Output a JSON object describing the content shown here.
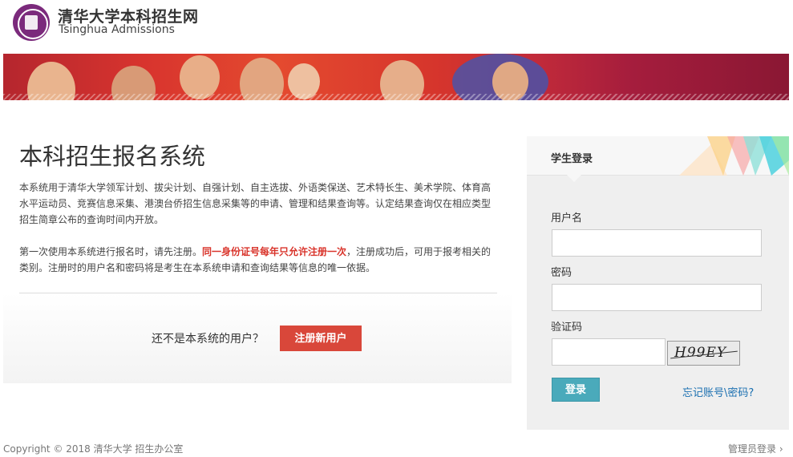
{
  "header": {
    "logo_cn": "清华大学本科招生网",
    "logo_en": "Tsinghua Admissions"
  },
  "intro": {
    "title": "本科招生报名系统",
    "para1": "本系统用于清华大学领军计划、拔尖计划、自强计划、自主选拔、外语类保送、艺术特长生、美术学院、体育高水平运动员、竞赛信息采集、港澳台侨招生信息采集等的申请、管理和结果查询等。认定结果查询仅在相应类型招生简章公布的查询时间内开放。",
    "para2_a": "第一次使用本系统进行报名时，请先注册。",
    "para2_red": "同一身份证号每年只允许注册一次",
    "para2_b": "，注册成功后，可用于报考相关的类别。注册时的用户名和密码将是考生在本系统申请和查询结果等信息的唯一依据。",
    "reg_question": "还不是本系统的用户？",
    "reg_button": "注册新用户"
  },
  "login": {
    "title": "学生登录",
    "username_label": "用户名",
    "username_value": "",
    "password_label": "密码",
    "password_value": "",
    "captcha_label": "验证码",
    "captcha_value": "",
    "captcha_text": "H99EY",
    "login_button": "登录",
    "forgot_link": "忘记账号\\密码?"
  },
  "footer": {
    "copyright": "Copyright © 2018 清华大学 招生办公室",
    "admin_login": "管理员登录 ›"
  },
  "colors": {
    "accent_red": "#d9473a",
    "login_blue": "#4aaabb",
    "link_blue": "#1a6fb0",
    "brand_purple": "#7b2a7c"
  }
}
